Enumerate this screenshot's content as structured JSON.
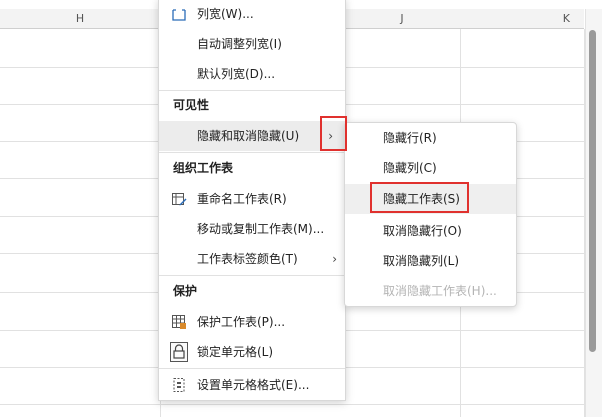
{
  "columns": [
    "H",
    "J",
    "K"
  ],
  "main_menu": {
    "items_top": [
      {
        "label": "列宽(W)...",
        "icon": "column-width-icon"
      },
      {
        "label": "自动调整列宽(I)"
      },
      {
        "label": "默认列宽(D)..."
      }
    ],
    "section_visibility": "可见性",
    "hide_unhide": {
      "label": "隐藏和取消隐藏(U)",
      "arrow": "›"
    },
    "section_organize": "组织工作表",
    "organize_items": [
      {
        "label": "重命名工作表(R)",
        "icon": "rename-sheet-icon"
      },
      {
        "label": "移动或复制工作表(M)..."
      },
      {
        "label": "工作表标签颜色(T)",
        "arrow": "›"
      }
    ],
    "section_protect": "保护",
    "protect_items": [
      {
        "label": "保护工作表(P)...",
        "icon": "protect-sheet-icon"
      },
      {
        "label": "锁定单元格(L)",
        "icon": "lock-icon"
      }
    ],
    "format_cells": {
      "label": "设置单元格格式(E)...",
      "icon": "format-cells-icon"
    }
  },
  "sub_menu": {
    "items": [
      {
        "label": "隐藏行(R)"
      },
      {
        "label": "隐藏列(C)"
      },
      {
        "label": "隐藏工作表(S)"
      },
      {
        "label": "取消隐藏行(O)"
      },
      {
        "label": "取消隐藏列(L)"
      },
      {
        "label": "取消隐藏工作表(H)..."
      }
    ]
  },
  "colors": {
    "highlight_box": "#e0312e",
    "menu_hover": "#ececec"
  }
}
